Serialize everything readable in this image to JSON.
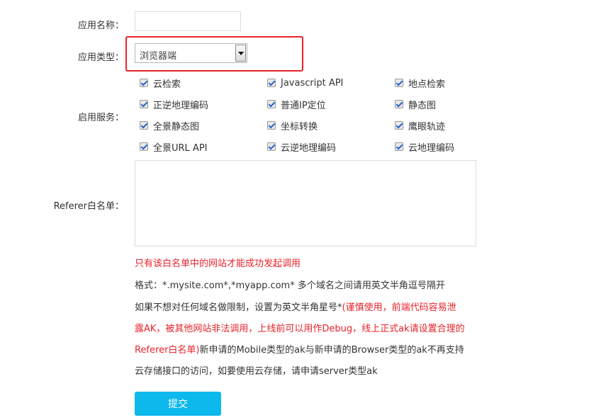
{
  "form": {
    "app_name_label": "应用名称：",
    "app_name_value": "",
    "app_type_label": "应用类型：",
    "app_type_selected": "浏览器端",
    "services_label": "启用服务：",
    "services": [
      {
        "label": "云检索",
        "checked": true
      },
      {
        "label": "Javascript API",
        "checked": true
      },
      {
        "label": "地点检索",
        "checked": true
      },
      {
        "label": "正逆地理编码",
        "checked": true
      },
      {
        "label": "普通IP定位",
        "checked": true
      },
      {
        "label": "静态图",
        "checked": true
      },
      {
        "label": "全景静态图",
        "checked": true
      },
      {
        "label": "坐标转换",
        "checked": true
      },
      {
        "label": "鹰眼轨迹",
        "checked": true
      },
      {
        "label": "全景URL API",
        "checked": true
      },
      {
        "label": "云逆地理编码",
        "checked": true
      },
      {
        "label": "云地理编码",
        "checked": true
      }
    ],
    "referer_label": "Referer白名单：",
    "referer_value": "",
    "notes": {
      "line1": "只有该白名单中的网站才能成功发起调用",
      "line2": "格式：*.mysite.com*,*myapp.com* 多个域名之间请用英文半角逗号隔开",
      "line3_normal": "如果不想对任何域名做限制，设置为英文半角星号*",
      "line3_red": "(谨慎使用，前端代码容易泄",
      "line4_red": "露AK，被其他网站非法调用，上线前可以用作Debug，线上正式ak请设置合理的",
      "line5_red": "Referer白名单)",
      "line5_normal": "新申请的Mobile类型的ak与新申请的Browser类型的ak不再支持",
      "line6": "云存储接口的访问，如要使用云存储，请申请server类型ak"
    },
    "submit_label": "提交"
  },
  "colors": {
    "accent_red": "#e8232a",
    "submit_bg": "#0db8ec",
    "checkbox_check": "#2c64c8"
  }
}
